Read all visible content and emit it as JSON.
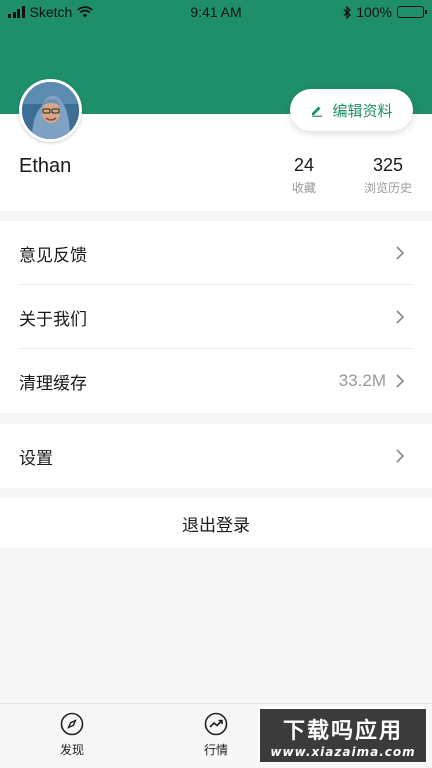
{
  "status_bar": {
    "carrier": "Sketch",
    "time": "9:41 AM",
    "battery": "100%"
  },
  "profile": {
    "username": "Ethan",
    "edit_label": "编辑资料",
    "stats": [
      {
        "value": "24",
        "label": "收藏"
      },
      {
        "value": "325",
        "label": "浏览历史"
      }
    ]
  },
  "menu": {
    "group1": [
      {
        "label": "意见反馈",
        "value": ""
      },
      {
        "label": "关于我们",
        "value": ""
      },
      {
        "label": "清理缓存",
        "value": "33.2M"
      }
    ],
    "group2": [
      {
        "label": "设置",
        "value": ""
      }
    ]
  },
  "logout_label": "退出登录",
  "tabbar": {
    "tabs": [
      {
        "label": "发现",
        "icon": "compass-icon"
      },
      {
        "label": "行情",
        "icon": "trend-up-icon"
      }
    ]
  },
  "watermark": {
    "title": "下载吗应用",
    "url": "www.xiazaima.com"
  },
  "colors": {
    "accent": "#1f8f6b",
    "background": "#f6f6f6",
    "secondary_text": "#999999"
  }
}
